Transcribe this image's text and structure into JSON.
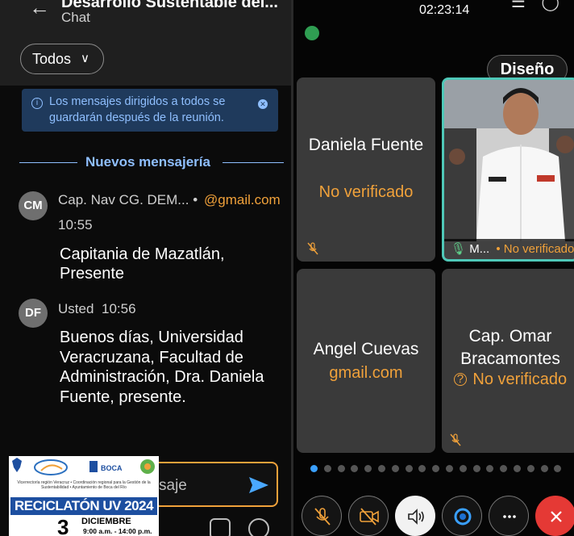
{
  "chat": {
    "meeting_title": "Desarrollo Sustentable del...",
    "subtitle": "Chat",
    "filter": "Todos",
    "notice": "Los mensajes dirigidos a todos se guardarán después de la reunión.",
    "new_messages_divider": "Nuevos mensajería",
    "messages": [
      {
        "avatar": "CM",
        "sender": "Cap. Nav CG. DEM... •",
        "email": "@gmail.com",
        "time": "10:55",
        "body": "Capitania de Mazatlán, Presente"
      },
      {
        "avatar": "DF",
        "sender": "Usted",
        "time": "10:56",
        "body": "Buenos días, Universidad Veracruzana, Facultad de Administración, Dra. Daniela Fuente, presente."
      }
    ],
    "compose_placeholder": "saje",
    "poster": {
      "title": "RECICLATÓN UV 2024",
      "day": "3",
      "month": "DICIEMBRE",
      "hours": "9:00 a.m. - 14:00 p.m.",
      "logo_text": "BOCA",
      "small_text": "Vicerrectoría región Veracruz • Coordinación regional para la Gestión de la Sustentabilidad • Ayuntamiento de Boca del Río"
    }
  },
  "meeting": {
    "clock": "02:23:14",
    "layout_button": "Diseño",
    "participants": [
      {
        "name": "Daniela Fuente",
        "status": "No verificado"
      },
      {
        "name": "M...",
        "status": "• No verificado"
      },
      {
        "name": "Angel Cuevas",
        "status": "gmail.com"
      },
      {
        "name": "Cap. Omar Bracamontes",
        "status": "No verificado"
      }
    ],
    "page_dots": 19,
    "active_dot": 0,
    "colors": {
      "accent_orange": "#f0a13a",
      "active_tile_border": "#4fc8b8",
      "end_call": "#e53935",
      "info_blue": "#8fbfff"
    }
  }
}
